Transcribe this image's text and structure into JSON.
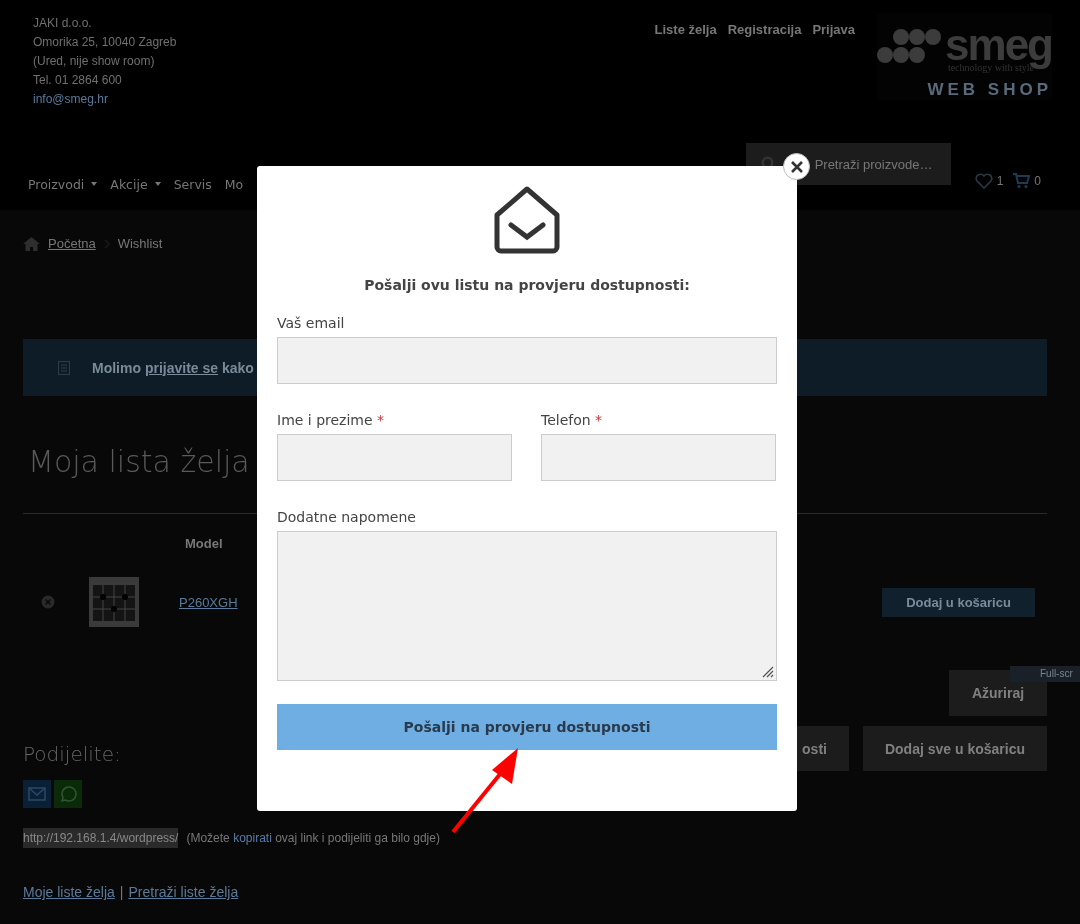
{
  "company": {
    "lines": [
      "JAKI d.o.o.",
      "Omorika 25, 10040 Zagreb",
      "(Ured, nije show room)",
      "Tel. 01 2864 600"
    ],
    "email": "info@smeg.hr"
  },
  "top_links": [
    "Liste želja",
    "Registracija",
    "Prijava"
  ],
  "logo": {
    "wordmark": "smeg",
    "tagline": "technology with style",
    "subtitle": "WEB SHOP"
  },
  "nav": [
    {
      "label": "Proizvodi",
      "dropdown": true
    },
    {
      "label": "Akcije",
      "dropdown": true
    },
    {
      "label": "Servis",
      "dropdown": false
    },
    {
      "label": "Mo",
      "dropdown": false
    }
  ],
  "search": {
    "placeholder": "Pretraži proizvode…"
  },
  "wishlist_count": "1",
  "cart_count": "0",
  "breadcrumb": [
    "Početna",
    "Wishlist"
  ],
  "notice": {
    "before": "Molimo ",
    "link": "prijavite se",
    "after": " kako"
  },
  "page_title": "Moja lista želja",
  "table": {
    "columns": [
      "Model"
    ],
    "rows": [
      {
        "model": "P260XGH",
        "button": "Dodaj u košaricu"
      }
    ]
  },
  "update_button": "Ažuriraj",
  "action_buttons": [
    "osti",
    "Dodaj sve u košaricu"
  ],
  "tooltip": "Full-scr",
  "share": {
    "title": "Podijelite:",
    "url": "http://192.168.1.4/wordpress/",
    "note_before": "(Možete ",
    "note_link": "kopirati",
    "note_after": " ovaj link i podijeliti ga bilo gdje)"
  },
  "footer_links": {
    "items": [
      "Moje liste želja",
      "Pretraži liste želja"
    ],
    "separator": "|"
  },
  "modal": {
    "heading": "Pošalji ovu listu na provjeru dostupnosti:",
    "required_mark": "*",
    "fields": [
      {
        "label": "Vaš email",
        "required": false,
        "kind": "input"
      },
      {
        "label": "Ime i prezime",
        "required": true,
        "kind": "input"
      },
      {
        "label": "Telefon",
        "required": true,
        "kind": "input"
      },
      {
        "label": "Dodatne napomene",
        "required": false,
        "kind": "textarea"
      }
    ],
    "submit": "Pošalji na provjeru dostupnosti"
  }
}
